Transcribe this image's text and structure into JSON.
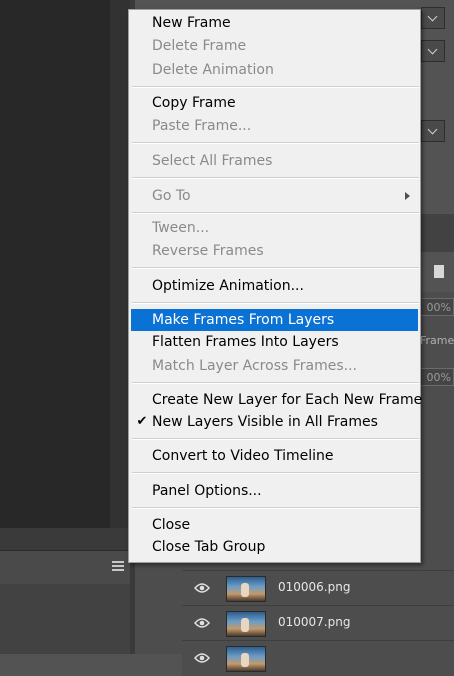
{
  "menu": {
    "items": [
      {
        "label": "New Frame",
        "enabled": true
      },
      {
        "label": "Delete Frame",
        "enabled": false
      },
      {
        "label": "Delete Animation",
        "enabled": false
      },
      {
        "label": "Copy Frame",
        "enabled": true
      },
      {
        "label": "Paste Frame...",
        "enabled": false
      },
      {
        "label": "Select All Frames",
        "enabled": false
      },
      {
        "label": "Go To",
        "enabled": false,
        "submenu": true
      },
      {
        "label": "Tween...",
        "enabled": false
      },
      {
        "label": "Reverse Frames",
        "enabled": false
      },
      {
        "label": "Optimize Animation...",
        "enabled": true
      },
      {
        "label": "Make Frames From Layers",
        "enabled": true,
        "highlighted": true
      },
      {
        "label": "Flatten Frames Into Layers",
        "enabled": true
      },
      {
        "label": "Match Layer Across Frames...",
        "enabled": false
      },
      {
        "label": "Create New Layer for Each New Frame",
        "enabled": true
      },
      {
        "label": "New Layers Visible in All Frames",
        "enabled": true,
        "checked": true,
        "check_glyph": "✔"
      },
      {
        "label": "Convert to Video Timeline",
        "enabled": true
      },
      {
        "label": "Panel Options...",
        "enabled": true
      },
      {
        "label": "Close",
        "enabled": true
      },
      {
        "label": "Close Tab Group",
        "enabled": true
      }
    ]
  },
  "layers_panel": {
    "percent_values": [
      "00%",
      "00%"
    ],
    "frame_label": "Frame",
    "layers": [
      {
        "name": "010006.png",
        "visible": true
      },
      {
        "name": "010007.png",
        "visible": true
      }
    ]
  },
  "colors": {
    "menu_bg": "#f0f0f0",
    "highlight": "#0a72d4",
    "disabled_text": "#8a8a8a",
    "workspace_bg": "#535353"
  }
}
